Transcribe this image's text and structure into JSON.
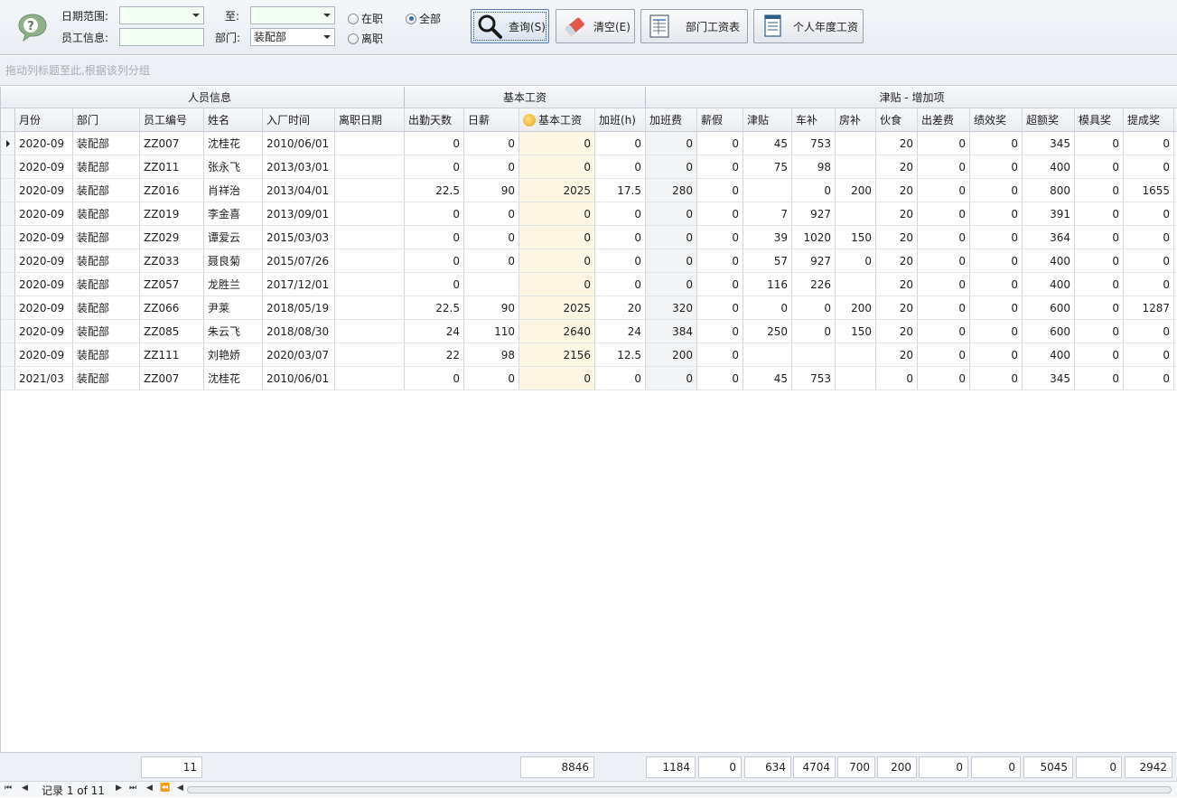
{
  "toolbar": {
    "date_range_label": "日期范围:",
    "to_label": "至:",
    "employee_info_label": "员工信息:",
    "dept_label": "部门:",
    "dept_value": "装配部",
    "radio_active": "在职",
    "radio_left": "离职",
    "radio_all": "全部",
    "query_button": "查询(S)",
    "clear_button": "清空(E)",
    "dept_salary_button": "部门工资表",
    "personal_year_button": "个人年度工资"
  },
  "group_panel_hint": "拖动列标题至此,根据该列分组",
  "bands": {
    "personnel": "人员信息",
    "basic_salary": "基本工资",
    "allowance": "津贴 - 增加项"
  },
  "columns": [
    "月份",
    "部门",
    "员工编号",
    "姓名",
    "入厂时间",
    "离职日期",
    "出勤天数",
    "日薪",
    "基本工资",
    "加班(h)",
    "加班费",
    "薪假",
    "津贴",
    "车补",
    "房补",
    "伙食",
    "出差费",
    "绩效奖",
    "超额奖",
    "模具奖",
    "提成奖"
  ],
  "rows": [
    [
      "2020-09",
      "装配部",
      "ZZ007",
      "沈桂花",
      "2010/06/01",
      "",
      "0",
      "0",
      "0",
      "0",
      "0",
      "0",
      "45",
      "753",
      "",
      "20",
      "0",
      "0",
      "345",
      "0",
      "0"
    ],
    [
      "2020-09",
      "装配部",
      "ZZ011",
      "张永飞",
      "2013/03/01",
      "",
      "0",
      "0",
      "0",
      "0",
      "0",
      "0",
      "75",
      "98",
      "",
      "20",
      "0",
      "0",
      "400",
      "0",
      "0"
    ],
    [
      "2020-09",
      "装配部",
      "ZZ016",
      "肖祥治",
      "2013/04/01",
      "",
      "22.5",
      "90",
      "2025",
      "17.5",
      "280",
      "0",
      "",
      "0",
      "200",
      "20",
      "0",
      "0",
      "800",
      "0",
      "1655"
    ],
    [
      "2020-09",
      "装配部",
      "ZZ019",
      "李金喜",
      "2013/09/01",
      "",
      "0",
      "0",
      "0",
      "0",
      "0",
      "0",
      "7",
      "927",
      "",
      "20",
      "0",
      "0",
      "391",
      "0",
      "0"
    ],
    [
      "2020-09",
      "装配部",
      "ZZ029",
      "谭爱云",
      "2015/03/03",
      "",
      "0",
      "0",
      "0",
      "0",
      "0",
      "0",
      "39",
      "1020",
      "150",
      "20",
      "0",
      "0",
      "364",
      "0",
      "0"
    ],
    [
      "2020-09",
      "装配部",
      "ZZ033",
      "聂良菊",
      "2015/07/26",
      "",
      "0",
      "0",
      "0",
      "0",
      "0",
      "0",
      "57",
      "927",
      "0",
      "20",
      "0",
      "0",
      "400",
      "0",
      "0"
    ],
    [
      "2020-09",
      "装配部",
      "ZZ057",
      "龙胜兰",
      "2017/12/01",
      "",
      "0",
      "",
      "0",
      "0",
      "0",
      "0",
      "116",
      "226",
      "",
      "20",
      "0",
      "0",
      "400",
      "0",
      "0"
    ],
    [
      "2020-09",
      "装配部",
      "ZZ066",
      "尹莱",
      "2018/05/19",
      "",
      "22.5",
      "90",
      "2025",
      "20",
      "320",
      "0",
      "0",
      "0",
      "200",
      "20",
      "0",
      "0",
      "600",
      "0",
      "1287"
    ],
    [
      "2020-09",
      "装配部",
      "ZZ085",
      "朱云飞",
      "2018/08/30",
      "",
      "24",
      "110",
      "2640",
      "24",
      "384",
      "0",
      "250",
      "0",
      "150",
      "20",
      "0",
      "0",
      "600",
      "0",
      "0"
    ],
    [
      "2020-09",
      "装配部",
      "ZZ111",
      "刘艳娇",
      "2020/03/07",
      "",
      "22",
      "98",
      "2156",
      "12.5",
      "200",
      "0",
      "",
      "",
      "",
      "20",
      "0",
      "0",
      "400",
      "0",
      "0"
    ],
    [
      "2021/03",
      "装配部",
      "ZZ007",
      "沈桂花",
      "2010/06/01",
      "",
      "0",
      "0",
      "0",
      "0",
      "0",
      "0",
      "45",
      "753",
      "",
      "0",
      "0",
      "0",
      "345",
      "0",
      "0"
    ]
  ],
  "footer": {
    "count": "11",
    "basic_salary_total": "8846",
    "overtime_fee_total": "1184",
    "paid_leave_total": "0",
    "allowance_total": "634",
    "car_total": "4704",
    "housing_total": "700",
    "meal_total": "200",
    "travel_total": "0",
    "performance_total": "0",
    "excess_total": "5045",
    "mold_total": "0",
    "commission_total": "2942"
  },
  "navigator": {
    "record_text": "记录 1 of 11"
  },
  "colors": {
    "highlight": "#fdf6e2",
    "accent": "#3a66b8"
  }
}
